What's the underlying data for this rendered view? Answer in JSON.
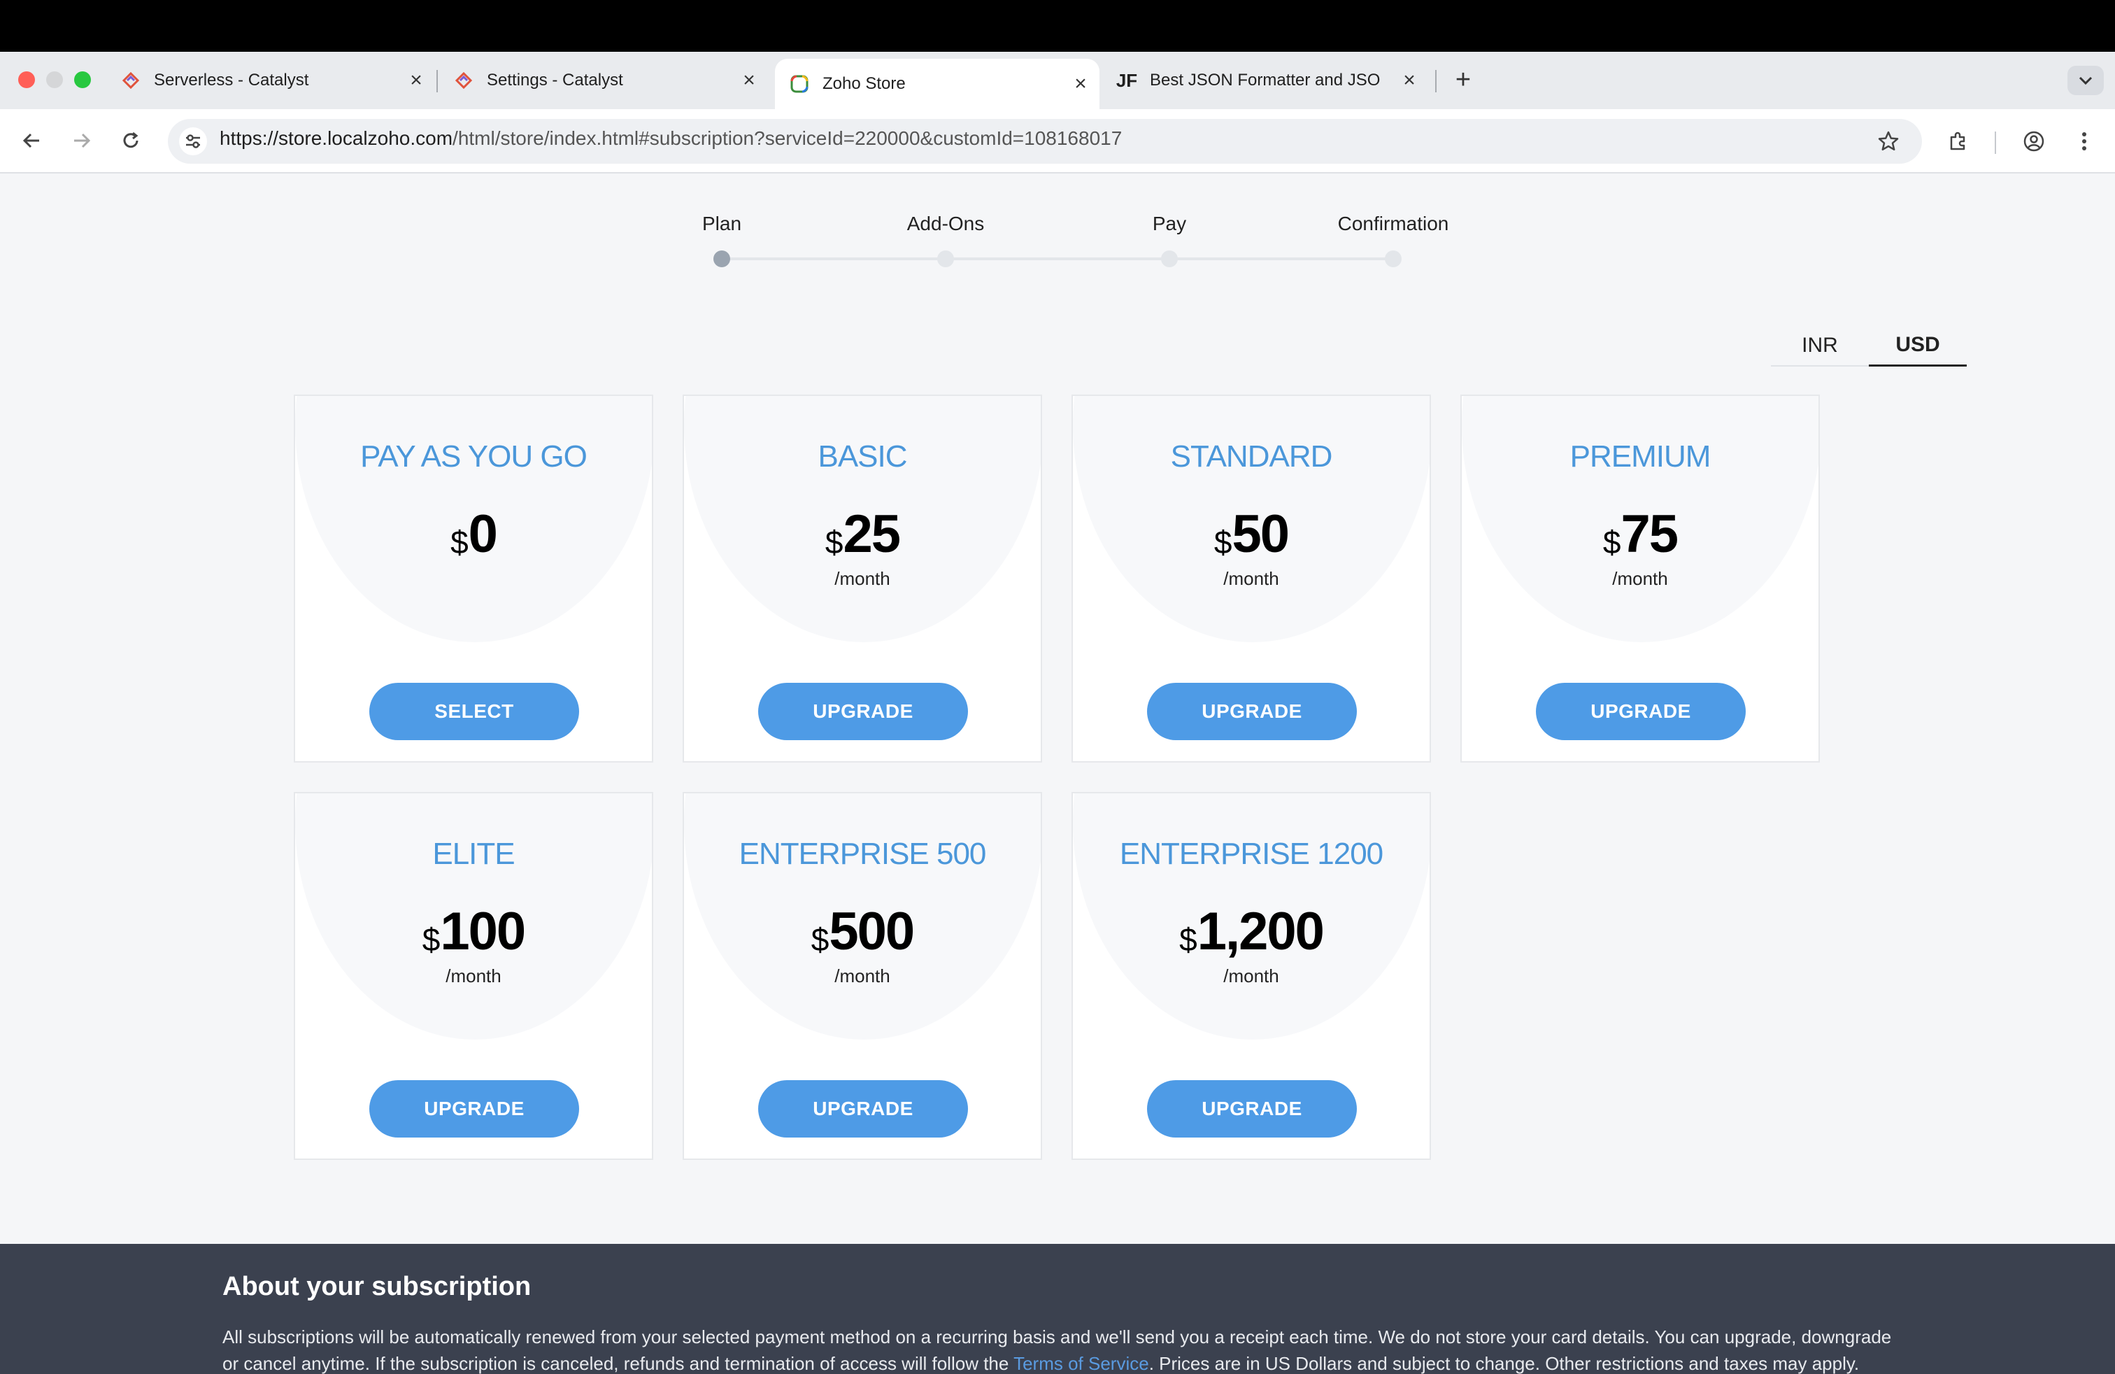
{
  "browser": {
    "tabs": [
      {
        "title": "Serverless - Catalyst",
        "favicon": "catalyst-icon",
        "active": false
      },
      {
        "title": "Settings - Catalyst",
        "favicon": "catalyst-icon",
        "active": false
      },
      {
        "title": "Zoho Store",
        "favicon": "zoho-icon",
        "active": true
      },
      {
        "title": "Best JSON Formatter and JSO",
        "favicon": "jf-icon",
        "favicon_text": "JF",
        "active": false
      }
    ],
    "url_host": "https://store.localzoho.com",
    "url_path": "/html/store/index.html#subscription?serviceId=220000&customId=108168017"
  },
  "stepper": {
    "steps": [
      {
        "label": "Plan",
        "active": true
      },
      {
        "label": "Add-Ons",
        "active": false
      },
      {
        "label": "Pay",
        "active": false
      },
      {
        "label": "Confirmation",
        "active": false
      }
    ]
  },
  "currency": {
    "options": [
      "INR",
      "USD"
    ],
    "selected": "USD"
  },
  "plans": [
    {
      "name": "PAY AS YOU GO",
      "symbol": "$",
      "amount": "0",
      "period": "",
      "button": "SELECT"
    },
    {
      "name": "BASIC",
      "symbol": "$",
      "amount": "25",
      "period": "/month",
      "button": "UPGRADE"
    },
    {
      "name": "STANDARD",
      "symbol": "$",
      "amount": "50",
      "period": "/month",
      "button": "UPGRADE"
    },
    {
      "name": "PREMIUM",
      "symbol": "$",
      "amount": "75",
      "period": "/month",
      "button": "UPGRADE"
    },
    {
      "name": "ELITE",
      "symbol": "$",
      "amount": "100",
      "period": "/month",
      "button": "UPGRADE"
    },
    {
      "name": "ENTERPRISE 500",
      "symbol": "$",
      "amount": "500",
      "period": "/month",
      "button": "UPGRADE"
    },
    {
      "name": "ENTERPRISE 1200",
      "symbol": "$",
      "amount": "1,200",
      "period": "/month",
      "button": "UPGRADE"
    }
  ],
  "about": {
    "title": "About your subscription",
    "text_before": "All subscriptions will be automatically renewed from your selected payment method on a recurring basis and we'll send you a receipt each time. We do not store your card details. You can upgrade, downgrade or cancel anytime. If the subscription is canceled, refunds and termination of access will follow the ",
    "link": "Terms of Service",
    "text_after": ". Prices are in US Dollars and subject to change. Other restrictions and taxes may apply."
  },
  "colors": {
    "accent": "#4e9be6",
    "plan_title": "#4b97da",
    "footer_bg": "#3b414f"
  }
}
